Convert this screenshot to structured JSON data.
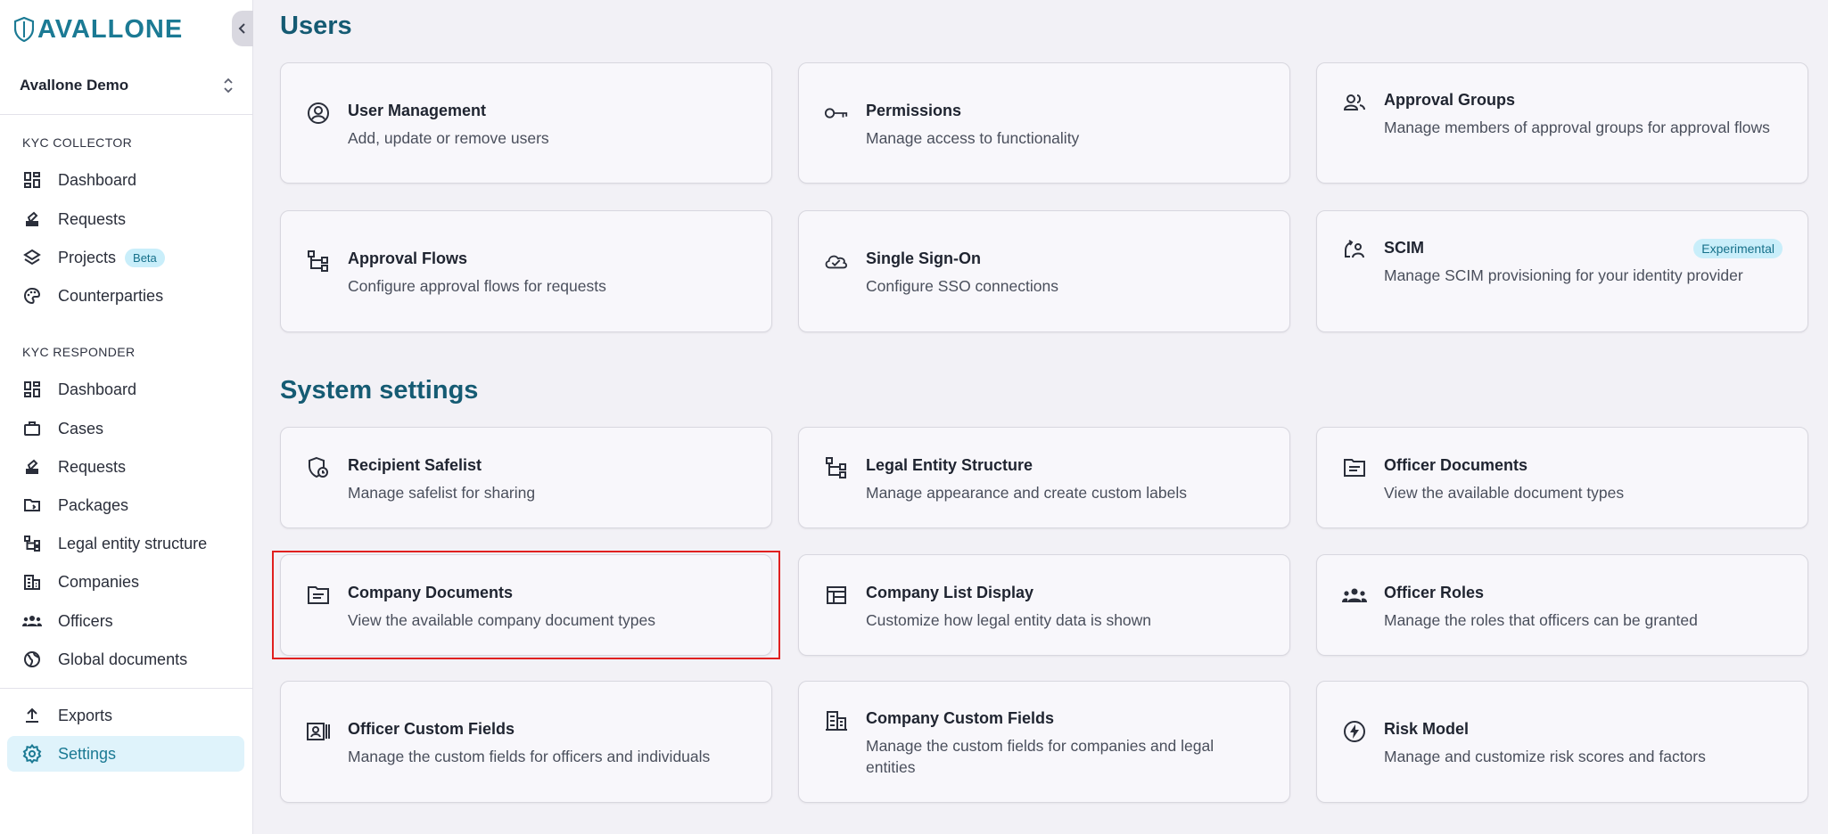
{
  "brand": {
    "logo_text": "AVALLONE"
  },
  "org": {
    "name": "Avallone Demo"
  },
  "sidebar": {
    "collector_label": "KYC COLLECTOR",
    "collector_items": [
      {
        "label": "Dashboard",
        "icon": "dashboard-icon"
      },
      {
        "label": "Requests",
        "icon": "stamp-icon"
      },
      {
        "label": "Projects",
        "icon": "layers-icon",
        "badge": "Beta"
      },
      {
        "label": "Counterparties",
        "icon": "palette-icon"
      }
    ],
    "responder_label": "KYC RESPONDER",
    "responder_items": [
      {
        "label": "Dashboard",
        "icon": "dashboard-icon"
      },
      {
        "label": "Cases",
        "icon": "briefcase-icon"
      },
      {
        "label": "Requests",
        "icon": "stamp-icon"
      },
      {
        "label": "Packages",
        "icon": "folder-icon"
      },
      {
        "label": "Legal entity structure",
        "icon": "tree-icon"
      },
      {
        "label": "Companies",
        "icon": "building-icon"
      },
      {
        "label": "Officers",
        "icon": "people-icon"
      },
      {
        "label": "Global documents",
        "icon": "globe-icon"
      }
    ],
    "bottom_items": [
      {
        "label": "Exports",
        "icon": "upload-icon"
      },
      {
        "label": "Settings",
        "icon": "gear-icon",
        "active": true
      }
    ]
  },
  "users_section": {
    "title": "Users",
    "cards": [
      {
        "title": "User Management",
        "desc": "Add, update or remove users",
        "icon": "user-circle-icon"
      },
      {
        "title": "Permissions",
        "desc": "Manage access to functionality",
        "icon": "key-icon"
      },
      {
        "title": "Approval Groups",
        "desc": "Manage members of approval groups for approval flows",
        "icon": "group-icon"
      },
      {
        "title": "Approval Flows",
        "desc": "Configure approval flows for requests",
        "icon": "flow-icon"
      },
      {
        "title": "Single Sign-On",
        "desc": "Configure SSO connections",
        "icon": "cloud-check-icon"
      },
      {
        "title": "SCIM",
        "desc": "Manage SCIM provisioning for your identity provider",
        "icon": "sync-user-icon",
        "badge": "Experimental"
      }
    ]
  },
  "system_section": {
    "title": "System settings",
    "cards": [
      {
        "title": "Recipient Safelist",
        "desc": "Manage safelist for sharing",
        "icon": "shield-clock-icon"
      },
      {
        "title": "Legal Entity Structure",
        "desc": "Manage appearance and create custom labels",
        "icon": "tree-icon"
      },
      {
        "title": "Officer Documents",
        "desc": "View the available document types",
        "icon": "folder-doc-icon"
      },
      {
        "title": "Company Documents",
        "desc": "View the available company document types",
        "icon": "folder-doc-icon"
      },
      {
        "title": "Company List Display",
        "desc": "Customize how legal entity data is shown",
        "icon": "table-layout-icon"
      },
      {
        "title": "Officer Roles",
        "desc": "Manage the roles that officers can be granted",
        "icon": "people-icon"
      },
      {
        "title": "Officer Custom Fields",
        "desc": "Manage the custom fields for officers and individuals",
        "icon": "id-card-icon"
      },
      {
        "title": "Company Custom Fields",
        "desc": "Manage the custom fields for companies and legal entities",
        "icon": "building-icon"
      },
      {
        "title": "Risk Model",
        "desc": "Manage and customize risk scores and factors",
        "icon": "bolt-circle-icon"
      }
    ]
  },
  "colors": {
    "accent": "#1b7a94",
    "heading": "#155b73",
    "highlight": "#e0201f"
  }
}
